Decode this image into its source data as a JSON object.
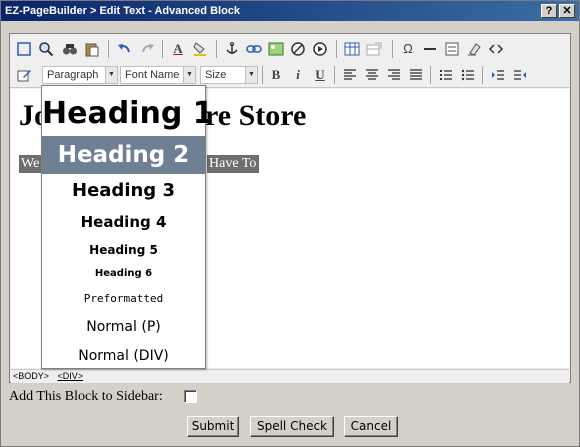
{
  "window": {
    "title": "EZ-PageBuilder > Edit Text - Advanced Block",
    "help_label": "?",
    "close_label": "✕"
  },
  "toolbar": {
    "format_combo": "Paragraph",
    "font_combo": "Font Name",
    "size_combo": "Size",
    "bold": "B",
    "italic": "i",
    "underline": "U",
    "text_color_glyph": "A",
    "omega_glyph": "Ω"
  },
  "content": {
    "heading_left": "Jo",
    "heading_right": "re Store",
    "highlight_left": "We",
    "highlight_right": "Have To"
  },
  "format_menu": {
    "items": [
      "Heading 1",
      "Heading 2",
      "Heading 3",
      "Heading 4",
      "Heading 5",
      "Heading 6",
      "Preformatted",
      "Normal (P)",
      "Normal (DIV)"
    ],
    "selected_index": 1
  },
  "statusbar": {
    "tags": [
      "<BODY>",
      "<DIV>"
    ]
  },
  "form": {
    "sidebar_label": "Add This Block to Sidebar:",
    "submit_label": "Submit",
    "spell_label": "Spell Check",
    "cancel_label": "Cancel"
  }
}
